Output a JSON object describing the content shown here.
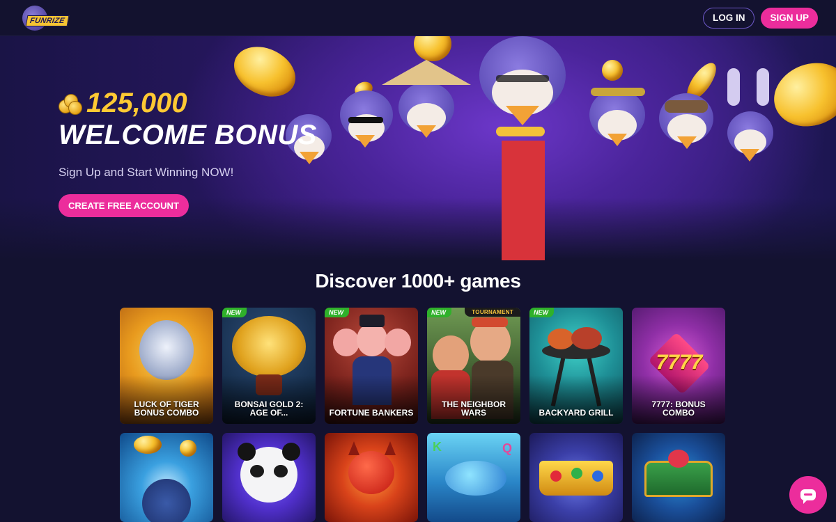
{
  "header": {
    "logo_text": "FUNRIZE",
    "login_label": "LOG IN",
    "signup_label": "SIGN UP"
  },
  "hero": {
    "bonus_amount": "125,000",
    "title": "WELCOME BONUS",
    "subtitle": "Sign Up and Start Winning NOW!",
    "cta_label": "CREATE FREE ACCOUNT"
  },
  "games": {
    "title": "Discover 1000+ games",
    "items": [
      {
        "name": "LUCK OF TIGER BONUS COMBO",
        "badge": ""
      },
      {
        "name": "BONSAI GOLD 2: AGE OF...",
        "badge": "NEW"
      },
      {
        "name": "FORTUNE BANKERS",
        "badge": "NEW"
      },
      {
        "name": "THE NEIGHBOR WARS",
        "badge": "NEW",
        "tag": "TOURNAMENT"
      },
      {
        "name": "BACKYARD GRILL",
        "badge": "NEW"
      },
      {
        "name": "7777: BONUS COMBO",
        "badge": ""
      }
    ],
    "icons": [
      "tiger-art",
      "bonsai-art",
      "pigs-art",
      "neighbors-art",
      "grill-art",
      "sevens-art",
      "wolf-art",
      "panda-art",
      "devil-art",
      "fish-art",
      "crown-art",
      "treasure-art"
    ]
  },
  "chat": {
    "icon": "chat-icon"
  },
  "colors": {
    "accent": "#ec2d9c",
    "gold": "#ffc933",
    "background": "#131230"
  }
}
